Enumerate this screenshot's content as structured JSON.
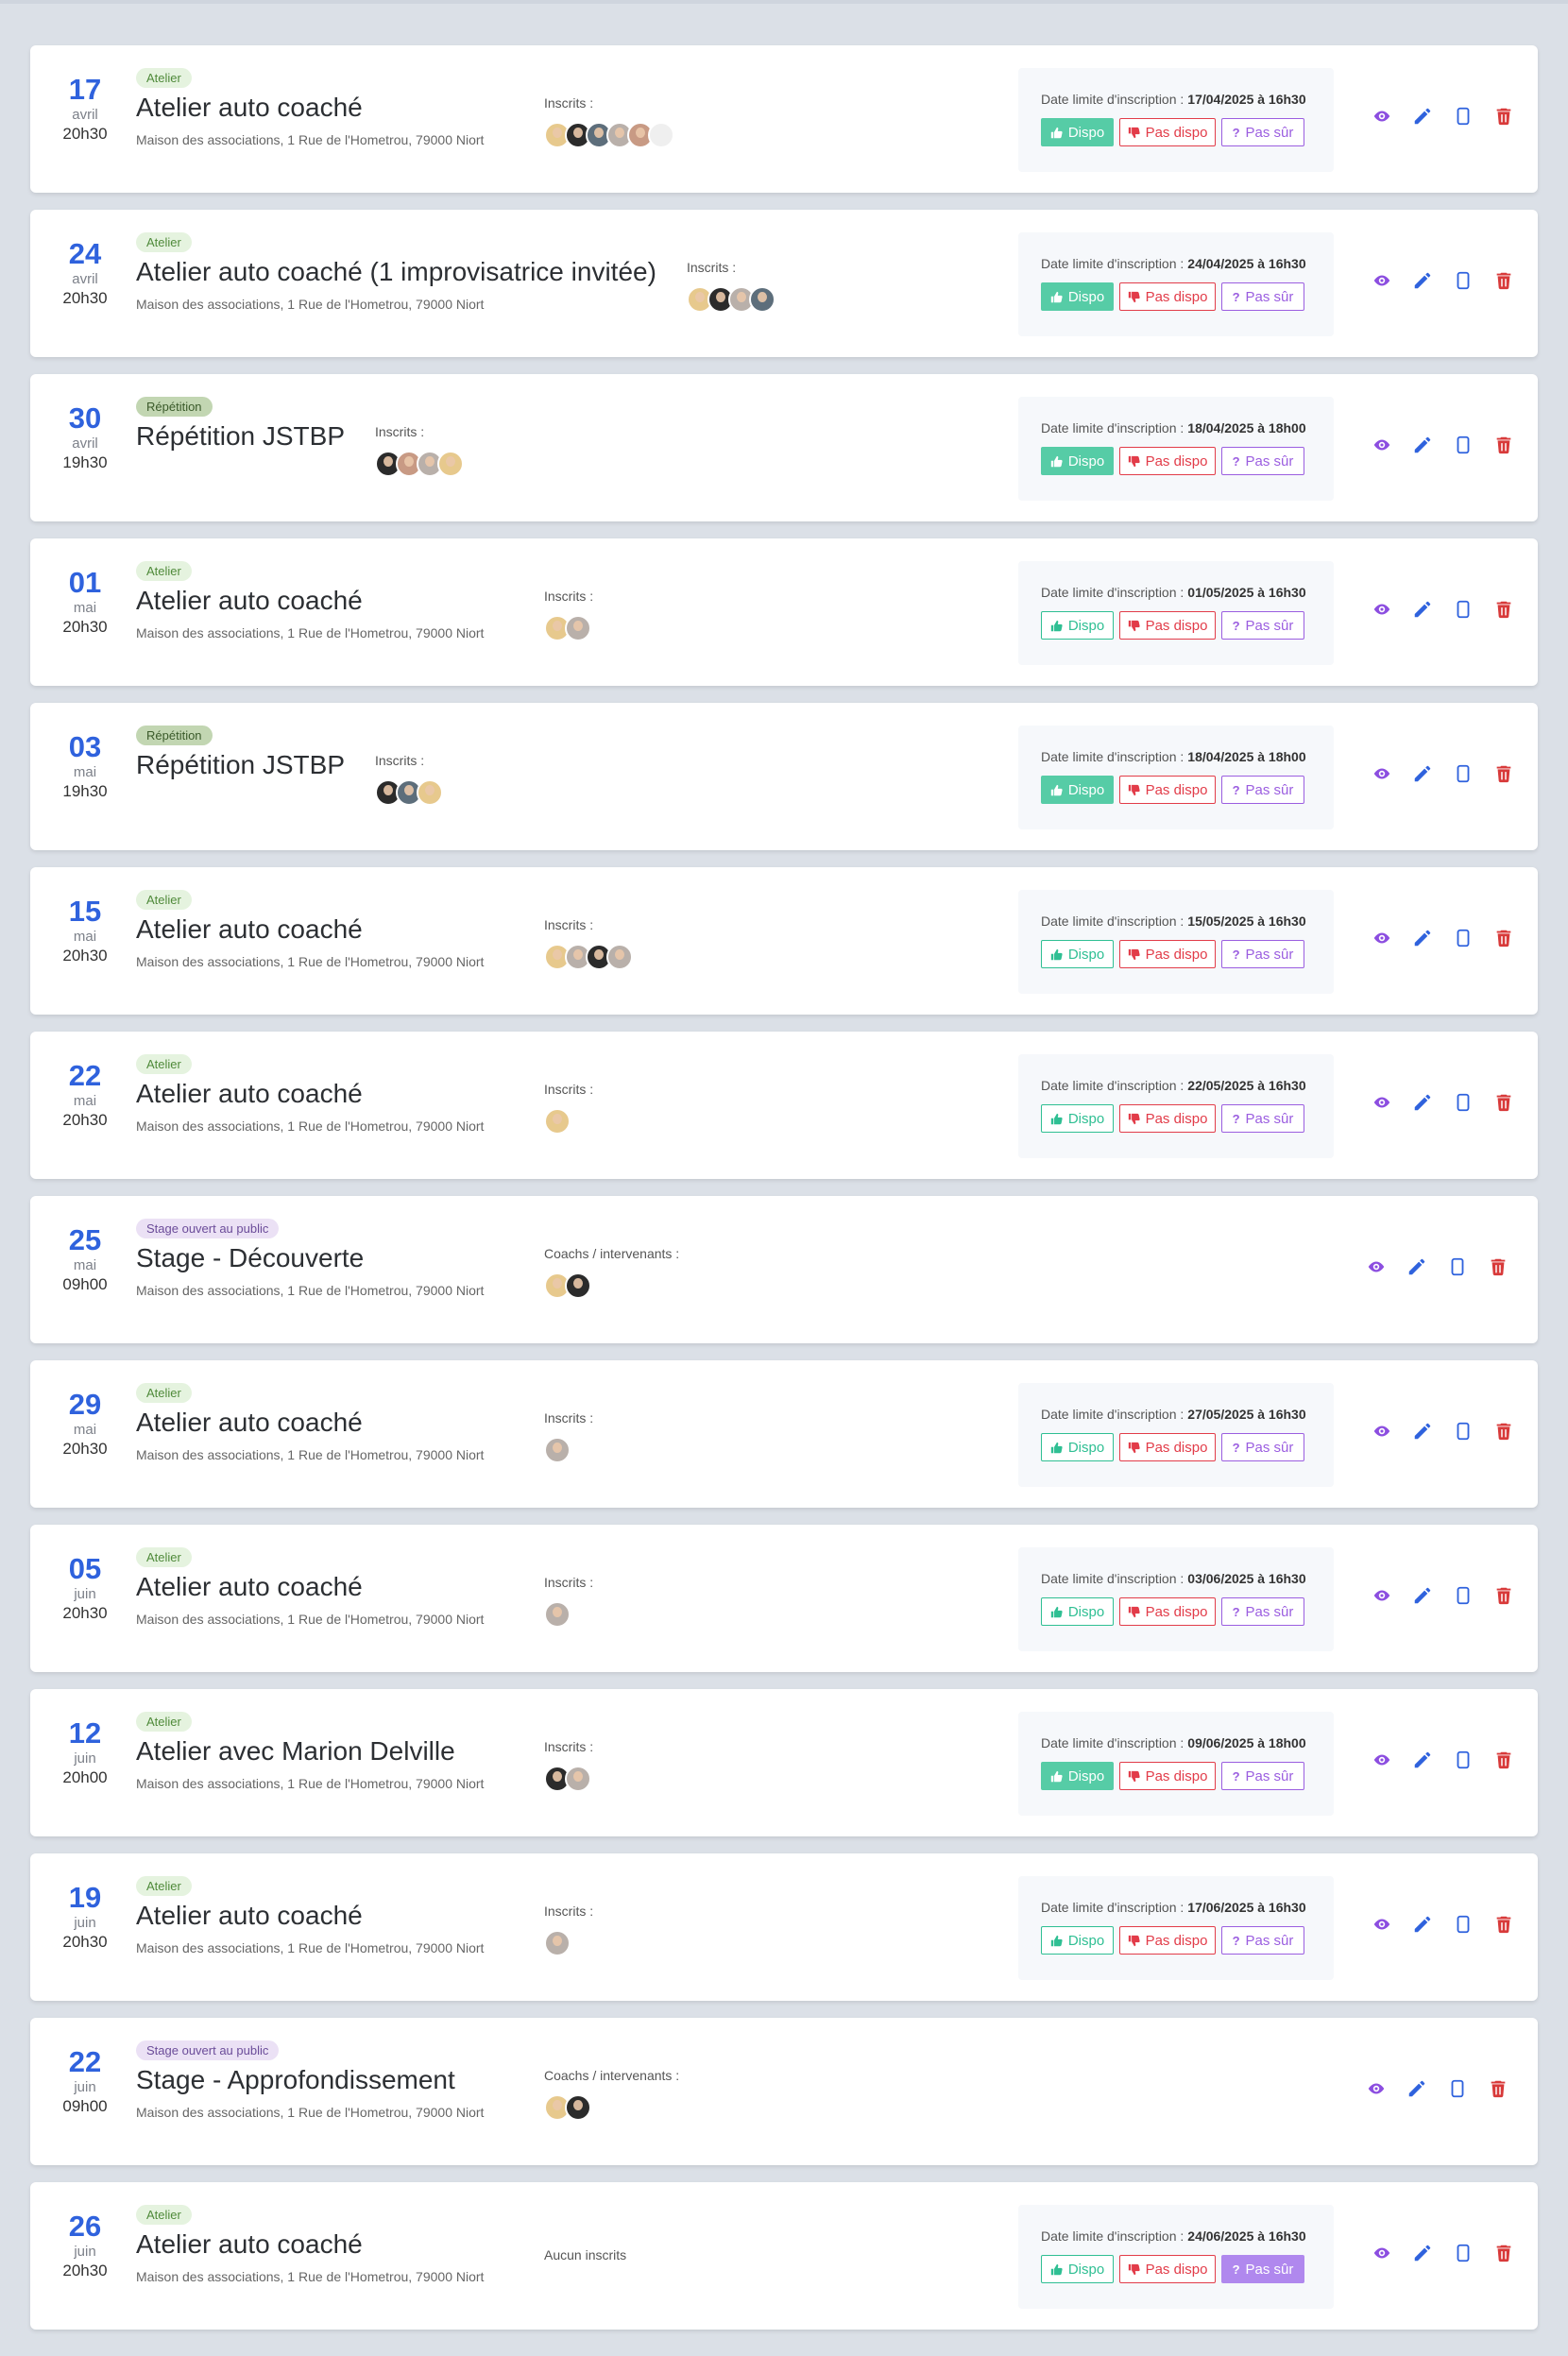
{
  "labels": {
    "registered": "Inscrits :",
    "coaches": "Coachs / intervenants :",
    "no_registered": "Aucun inscrits",
    "deadline": "Date limite d'inscription :",
    "dispo": "Dispo",
    "pas_dispo": "Pas dispo",
    "pas_sur": "Pas sûr"
  },
  "colors": {
    "accent_blue": "#2f62dd",
    "dispo_green": "#2fbf93",
    "pas_dispo_red": "#e23c49",
    "pas_sur_purple": "#9b5ee0",
    "view_icon": "#8c4ee0",
    "edit_icon": "#2f62dd",
    "delete_icon": "#d83a3a"
  },
  "icons": [
    "eye-icon",
    "pencil-icon",
    "copy-icon",
    "trash-icon",
    "thumbs-up-icon",
    "thumbs-down-icon",
    "question-icon"
  ],
  "events": [
    {
      "day": "17",
      "month": "avril",
      "time": "20h30",
      "tag": "Atelier",
      "tag_type": "atelier",
      "title": "Atelier auto coaché",
      "address": "Maison des associations, 1 Rue de l'Hometrou, 79000 Niort",
      "people_label": "registered",
      "avatars": [
        1,
        2,
        3,
        4,
        5,
        6
      ],
      "deadline": "17/04/2025 à 16h30",
      "selected": "dispo"
    },
    {
      "day": "24",
      "month": "avril",
      "time": "20h30",
      "tag": "Atelier",
      "tag_type": "atelier",
      "title": "Atelier auto coaché (1 improvisatrice invitée)",
      "address": "Maison des associations, 1 Rue de l'Hometrou, 79000 Niort",
      "people_label": "registered",
      "avatars": [
        1,
        2,
        4,
        3
      ],
      "deadline": "24/04/2025 à 16h30",
      "selected": "dispo"
    },
    {
      "day": "30",
      "month": "avril",
      "time": "19h30",
      "tag": "Répétition",
      "tag_type": "repetition",
      "title": "Répétition JSTBP",
      "address": "",
      "people_label": "registered",
      "avatars": [
        2,
        5,
        4,
        1
      ],
      "deadline": "18/04/2025 à 18h00",
      "selected": "dispo"
    },
    {
      "day": "01",
      "month": "mai",
      "time": "20h30",
      "tag": "Atelier",
      "tag_type": "atelier",
      "title": "Atelier auto coaché",
      "address": "Maison des associations, 1 Rue de l'Hometrou, 79000 Niort",
      "people_label": "registered",
      "avatars": [
        1,
        4
      ],
      "deadline": "01/05/2025 à 16h30",
      "selected": "none"
    },
    {
      "day": "03",
      "month": "mai",
      "time": "19h30",
      "tag": "Répétition",
      "tag_type": "repetition",
      "title": "Répétition JSTBP",
      "address": "",
      "people_label": "registered",
      "avatars": [
        2,
        3,
        1
      ],
      "deadline": "18/04/2025 à 18h00",
      "selected": "dispo"
    },
    {
      "day": "15",
      "month": "mai",
      "time": "20h30",
      "tag": "Atelier",
      "tag_type": "atelier",
      "title": "Atelier auto coaché",
      "address": "Maison des associations, 1 Rue de l'Hometrou, 79000 Niort",
      "people_label": "registered",
      "avatars": [
        1,
        4,
        2,
        4
      ],
      "deadline": "15/05/2025 à 16h30",
      "selected": "none"
    },
    {
      "day": "22",
      "month": "mai",
      "time": "20h30",
      "tag": "Atelier",
      "tag_type": "atelier",
      "title": "Atelier auto coaché",
      "address": "Maison des associations, 1 Rue de l'Hometrou, 79000 Niort",
      "people_label": "registered",
      "avatars": [
        1
      ],
      "deadline": "22/05/2025 à 16h30",
      "selected": "none"
    },
    {
      "day": "25",
      "month": "mai",
      "time": "09h00",
      "tag": "Stage ouvert au public",
      "tag_type": "stage",
      "title": "Stage - Découverte",
      "address": "Maison des associations, 1 Rue de l'Hometrou, 79000 Niort",
      "people_label": "coaches",
      "avatars": [
        1,
        2
      ],
      "deadline": "",
      "selected": "none"
    },
    {
      "day": "29",
      "month": "mai",
      "time": "20h30",
      "tag": "Atelier",
      "tag_type": "atelier",
      "title": "Atelier auto coaché",
      "address": "Maison des associations, 1 Rue de l'Hometrou, 79000 Niort",
      "people_label": "registered",
      "avatars": [
        4
      ],
      "deadline": "27/05/2025 à 16h30",
      "selected": "none"
    },
    {
      "day": "05",
      "month": "juin",
      "time": "20h30",
      "tag": "Atelier",
      "tag_type": "atelier",
      "title": "Atelier auto coaché",
      "address": "Maison des associations, 1 Rue de l'Hometrou, 79000 Niort",
      "people_label": "registered",
      "avatars": [
        4
      ],
      "deadline": "03/06/2025 à 16h30",
      "selected": "none"
    },
    {
      "day": "12",
      "month": "juin",
      "time": "20h00",
      "tag": "Atelier",
      "tag_type": "atelier",
      "title": "Atelier avec Marion Delville",
      "address": "Maison des associations, 1 Rue de l'Hometrou, 79000 Niort",
      "people_label": "registered",
      "avatars": [
        2,
        4
      ],
      "deadline": "09/06/2025 à 18h00",
      "selected": "dispo"
    },
    {
      "day": "19",
      "month": "juin",
      "time": "20h30",
      "tag": "Atelier",
      "tag_type": "atelier",
      "title": "Atelier auto coaché",
      "address": "Maison des associations, 1 Rue de l'Hometrou, 79000 Niort",
      "people_label": "registered",
      "avatars": [
        4
      ],
      "deadline": "17/06/2025 à 16h30",
      "selected": "none"
    },
    {
      "day": "22",
      "month": "juin",
      "time": "09h00",
      "tag": "Stage ouvert au public",
      "tag_type": "stage",
      "title": "Stage - Approfondissement",
      "address": "Maison des associations, 1 Rue de l'Hometrou, 79000 Niort",
      "people_label": "coaches",
      "avatars": [
        1,
        2
      ],
      "deadline": "",
      "selected": "none"
    },
    {
      "day": "26",
      "month": "juin",
      "time": "20h30",
      "tag": "Atelier",
      "tag_type": "atelier",
      "title": "Atelier auto coaché",
      "address": "Maison des associations, 1 Rue de l'Hometrou, 79000 Niort",
      "people_label": "none",
      "avatars": [],
      "deadline": "24/06/2025 à 16h30",
      "selected": "pas_sur"
    }
  ]
}
